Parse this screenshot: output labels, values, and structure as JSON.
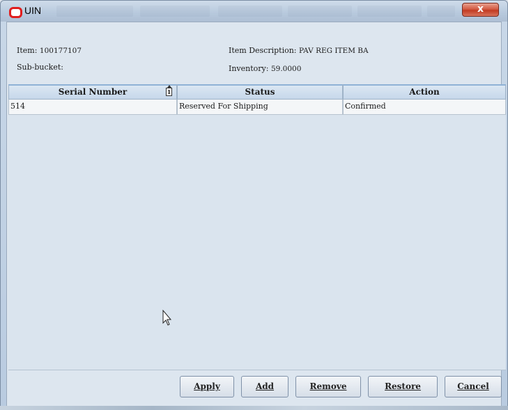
{
  "window": {
    "title": "UIN",
    "close_glyph": "x"
  },
  "info": {
    "item_label": "Item:",
    "item_value": "100177107",
    "sub_bucket_label": "Sub-bucket:",
    "description_label": "Item Description:",
    "description_value": "PAV REG ITEM BA",
    "inventory_label": "Inventory:",
    "inventory_value": "59.0000"
  },
  "table": {
    "columns": [
      "Serial Number",
      "Status",
      "Action"
    ],
    "sort_indicator": "1",
    "rows": [
      [
        "514",
        "Reserved For Shipping",
        "Confirmed"
      ]
    ]
  },
  "buttons": {
    "apply": "Apply",
    "add": "Add",
    "remove": "Remove",
    "restore": "Restore",
    "cancel": "Cancel"
  },
  "icons": {
    "app": "oracle-logo-icon",
    "close": "close-icon",
    "sort": "sort-ascending-icon",
    "cursor": "mouse-pointer-icon"
  },
  "colors": {
    "close_button": "#c23b22",
    "logo": "#e01e1e",
    "header_bg": "#c6d7ea"
  }
}
